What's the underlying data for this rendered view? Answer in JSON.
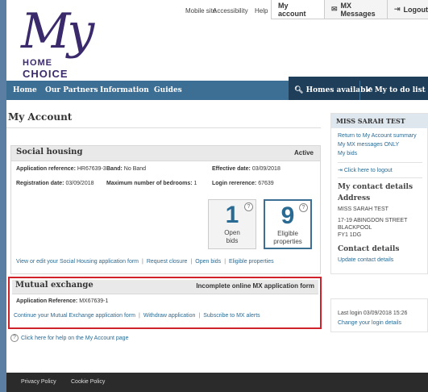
{
  "header": {
    "logo": {
      "my": "My",
      "home": "HOME",
      "choice": "CHOICE"
    },
    "top_links": {
      "mobile": "Mobile site",
      "accessibility": "Accessibility",
      "help": "Help"
    },
    "account_tabs": {
      "account": "My account",
      "messages": "MX Messages",
      "logout": "Logout"
    }
  },
  "nav": {
    "items": [
      "Home",
      "Our Partners",
      "Information",
      "Guides"
    ],
    "homes_available": "Homes available",
    "todo": "My to do list (0)"
  },
  "page_title": "My Account",
  "social_housing": {
    "title": "Social housing",
    "status": "Active",
    "app_ref_label": "Application reference:",
    "app_ref_value": "HR67639-3",
    "band_label": "Band:",
    "band_value": "No Band",
    "effective_label": "Effective date:",
    "effective_value": "03/09/2018",
    "reg_label": "Registration date:",
    "reg_value": "03/09/2018",
    "bedrooms_label": "Maximum number of bedrooms:",
    "bedrooms_value": "1",
    "login_ref_label": "Login rererence:",
    "login_ref_value": "67639",
    "tiles": [
      {
        "number": "1",
        "label_line1": "Open",
        "label_line2": "bids"
      },
      {
        "number": "9",
        "label_line1": "Eligible",
        "label_line2": "properties"
      }
    ],
    "links": [
      "View or edit your Social Housing application form",
      "Request closure",
      "Open bids",
      "Eligible properties"
    ]
  },
  "mutual_exchange": {
    "title": "Mutual exchange",
    "status": "Incomplete online MX application form",
    "ref_label": "Application Reference:",
    "ref_value": "MX67639-1",
    "links": [
      "Continue your Mutual Exchange application form",
      "Withdraw application",
      "Subscribe to MX alerts"
    ]
  },
  "help_link": "Click here for help on the My Account page",
  "sidebar": {
    "name": "MISS SARAH TEST",
    "links": [
      "Return to My Account summary",
      "My MX messages ONLY",
      "My bids"
    ],
    "logout": "Click here to logout",
    "contact_heading": "My contact details",
    "address_heading": "Address",
    "address_name": "MISS SARAH TEST",
    "address_line1": "17-19 ABINGDON STREET",
    "address_line2": "BLACKPOOL",
    "address_line3": "FY1 1DG",
    "contact_details_heading": "Contact details",
    "update_contact": "Update contact details",
    "last_login": "Last login 03/09/2018 15:26",
    "change_login": "Change your login details"
  },
  "footer": {
    "privacy": "Privacy Policy",
    "cookie": "Cookie Policy"
  },
  "colors": {
    "nav": "#3d6f95",
    "nav_dark": "#1f3e5a",
    "link": "#2b6b93",
    "highlight": "#d0222a",
    "logo": "#3b2a6b"
  }
}
